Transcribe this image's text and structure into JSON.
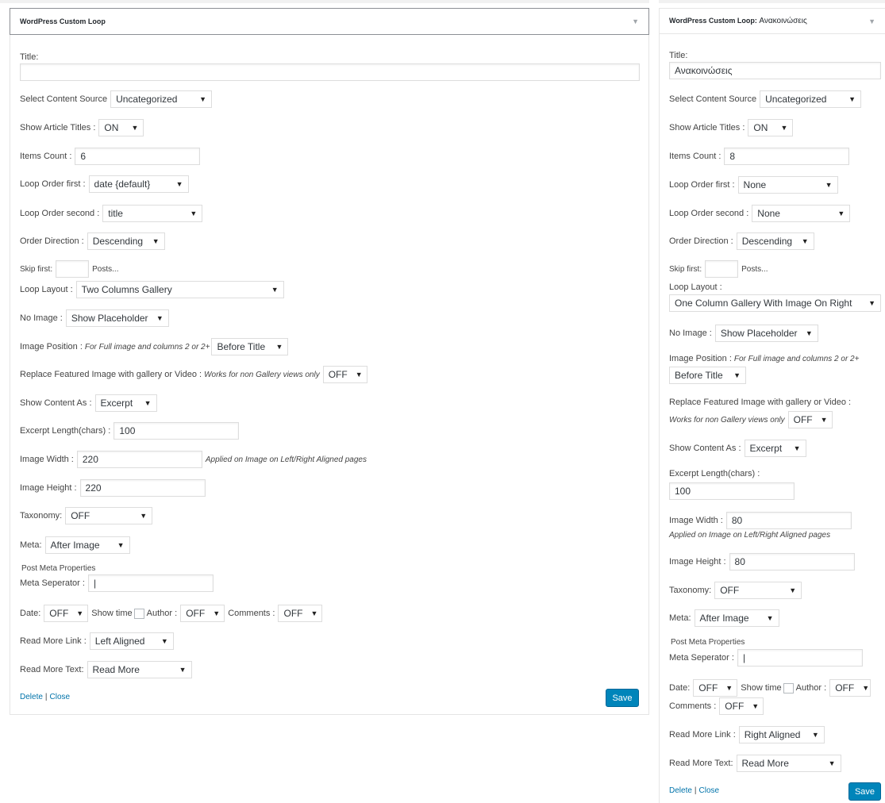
{
  "left": {
    "title": "WordPress Custom Loop",
    "title_field": {
      "label": "Title:",
      "value": ""
    },
    "content_source": {
      "label": "Select Content Source",
      "value": "Uncategorized"
    },
    "show_titles": {
      "label": "Show Article Titles :",
      "value": "ON"
    },
    "items_count": {
      "label": "Items Count :",
      "value": "6"
    },
    "order_first": {
      "label": "Loop Order first :",
      "value": "date {default}"
    },
    "order_second": {
      "label": "Loop Order second :",
      "value": "title"
    },
    "order_direction": {
      "label": "Order Direction :",
      "value": "Descending"
    },
    "skip_first": {
      "label": "Skip first:",
      "value": "",
      "suffix": "Posts..."
    },
    "loop_layout": {
      "label": "Loop Layout :",
      "value": "Two Columns Gallery"
    },
    "no_image": {
      "label": "No Image :",
      "value": "Show Placeholder"
    },
    "image_position": {
      "label": "Image Position :",
      "note": "For Full image and columns 2 or 2+",
      "value": "Before Title"
    },
    "replace_featured": {
      "label": "Replace Featured Image with gallery or Video :",
      "note": "Works for non Gallery views only",
      "value": "OFF"
    },
    "show_content": {
      "label": "Show Content As :",
      "value": "Excerpt"
    },
    "excerpt_length": {
      "label": "Excerpt Length(chars) :",
      "value": "100"
    },
    "image_width": {
      "label": "Image Width :",
      "value": "220",
      "note": "Applied on Image on Left/Right Aligned pages"
    },
    "image_height": {
      "label": "Image Height :",
      "value": "220"
    },
    "taxonomy": {
      "label": "Taxonomy:",
      "value": "OFF"
    },
    "meta": {
      "label": "Meta:",
      "value": "After Image"
    },
    "post_meta_props": "Post Meta Properties",
    "meta_separator": {
      "label": "Meta Seperator :",
      "value": "|"
    },
    "date": {
      "label": "Date:",
      "value": "OFF"
    },
    "show_time": "Show time",
    "author": {
      "label": "Author :",
      "value": "OFF"
    },
    "comments": {
      "label": "Comments :",
      "value": "OFF"
    },
    "read_more_link": {
      "label": "Read More Link :",
      "value": "Left Aligned"
    },
    "read_more_text": {
      "label": "Read More Text:",
      "value": "Read More"
    },
    "delete": "Delete",
    "close": "Close",
    "save": "Save"
  },
  "right": {
    "title": "WordPress Custom Loop:",
    "title_sub": "Ανακοινώσεις",
    "title_field": {
      "label": "Title:",
      "value": "Ανακοινώσεις"
    },
    "content_source": {
      "label": "Select Content Source",
      "value": "Uncategorized"
    },
    "show_titles": {
      "label": "Show Article Titles :",
      "value": "ON"
    },
    "items_count": {
      "label": "Items Count :",
      "value": "8"
    },
    "order_first": {
      "label": "Loop Order first :",
      "value": "None"
    },
    "order_second": {
      "label": "Loop Order second :",
      "value": "None"
    },
    "order_direction": {
      "label": "Order Direction :",
      "value": "Descending"
    },
    "skip_first": {
      "label": "Skip first:",
      "value": "",
      "suffix": "Posts..."
    },
    "loop_layout": {
      "label": "Loop Layout :",
      "value": "One Column Gallery With Image On Right"
    },
    "no_image": {
      "label": "No Image :",
      "value": "Show Placeholder"
    },
    "image_position": {
      "label": "Image Position :",
      "note": "For Full image and columns 2 or 2+",
      "value": "Before Title"
    },
    "replace_featured": {
      "label": "Replace Featured Image with gallery or Video :",
      "note": "Works for non Gallery views only",
      "value": "OFF"
    },
    "show_content": {
      "label": "Show Content As :",
      "value": "Excerpt"
    },
    "excerpt_length": {
      "label": "Excerpt Length(chars) :",
      "value": "100"
    },
    "image_width": {
      "label": "Image Width :",
      "value": "80",
      "note": "Applied on Image on Left/Right Aligned pages"
    },
    "image_height": {
      "label": "Image Height :",
      "value": "80"
    },
    "taxonomy": {
      "label": "Taxonomy:",
      "value": "OFF"
    },
    "meta": {
      "label": "Meta:",
      "value": "After Image"
    },
    "post_meta_props": "Post Meta Properties",
    "meta_separator": {
      "label": "Meta Seperator :",
      "value": "|"
    },
    "date": {
      "label": "Date:",
      "value": "OFF"
    },
    "show_time": "Show time",
    "author": {
      "label": "Author :",
      "value": "OFF"
    },
    "comments": {
      "label": "Comments :",
      "value": "OFF"
    },
    "read_more_link": {
      "label": "Read More Link :",
      "value": "Right Aligned"
    },
    "read_more_text": {
      "label": "Read More Text:",
      "value": "Read More"
    },
    "delete": "Delete",
    "close": "Close",
    "save": "Save"
  },
  "icons": {
    "collapse": "triangle-down-icon",
    "caret": "caret-down-icon"
  },
  "colors": {
    "save_button": "#0085ba",
    "link": "#0073aa",
    "border": "#dddddd"
  }
}
